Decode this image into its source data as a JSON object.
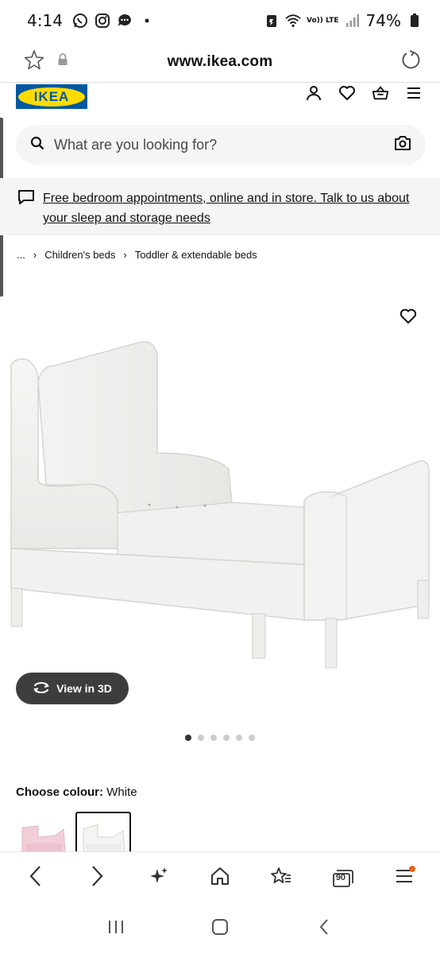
{
  "status_bar": {
    "time": "4:14",
    "network_label": "Vo)) LTE",
    "battery": "74%"
  },
  "url_bar": {
    "url": "www.ikea.com"
  },
  "header": {
    "logo_text": "IKEA"
  },
  "search": {
    "placeholder": "What are you looking for?"
  },
  "banner": {
    "text": "Free bedroom appointments, online and in store. Talk to us about your sleep and storage needs"
  },
  "breadcrumb": {
    "items": [
      "...",
      "Children's beds",
      "Toddler & extendable beds"
    ]
  },
  "product": {
    "view3d_label": "View in 3D",
    "image_count": 6,
    "active_image_index": 0,
    "colour_label": "Choose colour:",
    "colour_value": "White"
  },
  "colors": {
    "ikea_blue": "#0058a3",
    "ikea_yellow": "#ffdb00",
    "view3d_bg": "#3d3d3d",
    "notification_dot": "#e8661a"
  },
  "browser_toolbar": {
    "tabs_count": "90"
  }
}
